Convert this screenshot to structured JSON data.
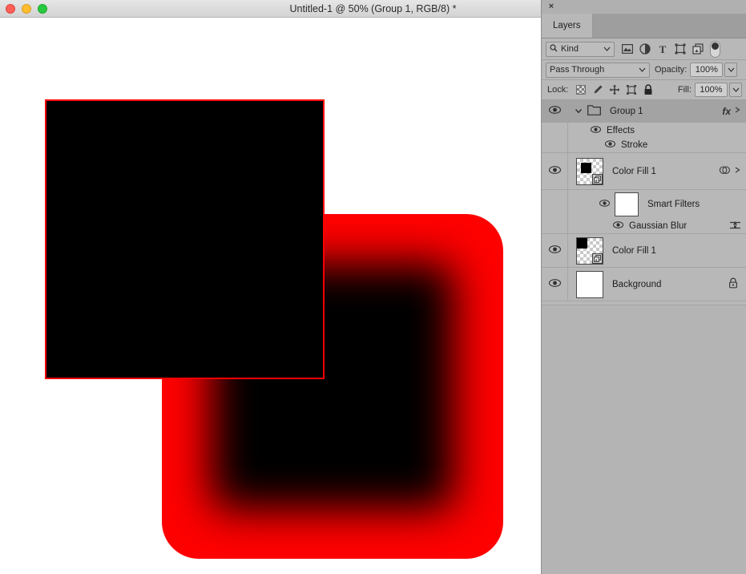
{
  "window": {
    "title": "Untitled-1 @ 50% (Group 1, RGB/8) *",
    "controls": {
      "close": "close",
      "minimize": "minimize",
      "zoom": "zoom"
    }
  },
  "canvas": {
    "document_zoom": "50%",
    "shapes": [
      {
        "name": "blurred-rounded-rect",
        "fill": "#fe0000",
        "core_fill": "#000000",
        "corner_radius_px": 46
      },
      {
        "name": "black-square-with-red-stroke",
        "fill": "#000000",
        "stroke": "#fe0000",
        "stroke_width_px": 2
      }
    ]
  },
  "panel": {
    "close_label": "×",
    "tab_label": "Layers",
    "filter": {
      "search_icon": "search-icon",
      "kind_label": "Kind",
      "chevron": "⌄",
      "icons": [
        {
          "name": "pixel-layer-filter-icon",
          "glyph": "image"
        },
        {
          "name": "adjustment-layer-filter-icon",
          "glyph": "half-circle"
        },
        {
          "name": "type-layer-filter-icon",
          "glyph": "T"
        },
        {
          "name": "shape-layer-filter-icon",
          "glyph": "shape"
        },
        {
          "name": "smart-object-filter-icon",
          "glyph": "smart-object"
        }
      ],
      "toggle_name": "filter-enable-toggle"
    },
    "blend": {
      "mode_label": "Pass Through",
      "chevron": "⌄",
      "opacity_label": "Opacity:",
      "opacity_value": "100%",
      "stepper": "⌄"
    },
    "lock": {
      "label": "Lock:",
      "fill_label": "Fill:",
      "fill_value": "100%",
      "stepper": "⌄",
      "icons": [
        {
          "name": "lock-transparent-pixels-icon"
        },
        {
          "name": "lock-image-pixels-icon"
        },
        {
          "name": "lock-position-icon"
        },
        {
          "name": "lock-artboard-nesting-icon"
        },
        {
          "name": "lock-all-icon"
        }
      ]
    },
    "layers": [
      {
        "type": "group",
        "name": "Group 1",
        "selected": true,
        "visible": true,
        "expanded": true,
        "badges": [
          "fx",
          "chevron"
        ],
        "children": [
          {
            "type": "effects-header",
            "name": "Effects",
            "visible": true
          },
          {
            "type": "effect",
            "name": "Stroke",
            "visible": true
          }
        ]
      },
      {
        "type": "smart-object",
        "name": "Color Fill 1",
        "selected": false,
        "visible": true,
        "thumb": "checkered-black-square",
        "badges": [
          "smart-filter",
          "chevron"
        ],
        "smart_filters": {
          "name": "Smart Filters",
          "visible": true,
          "mask_thumb": "white",
          "filters": [
            {
              "name": "Gaussian Blur",
              "visible": true,
              "badge": "blend-options-icon"
            }
          ]
        }
      },
      {
        "type": "smart-object",
        "name": "Color Fill 1",
        "selected": false,
        "visible": true,
        "thumb": "checkered-black-square",
        "badges": []
      },
      {
        "type": "background",
        "name": "Background",
        "selected": false,
        "visible": true,
        "thumb": "white",
        "badges": [
          "lock"
        ]
      }
    ]
  },
  "colors": {
    "panel_bg": "#b8b8b8",
    "row_selected": "#a3a3a3",
    "accent_red": "#fe0000",
    "titlebar_top": "#e6e6e6",
    "titlebar_bottom": "#d3d3d3"
  }
}
